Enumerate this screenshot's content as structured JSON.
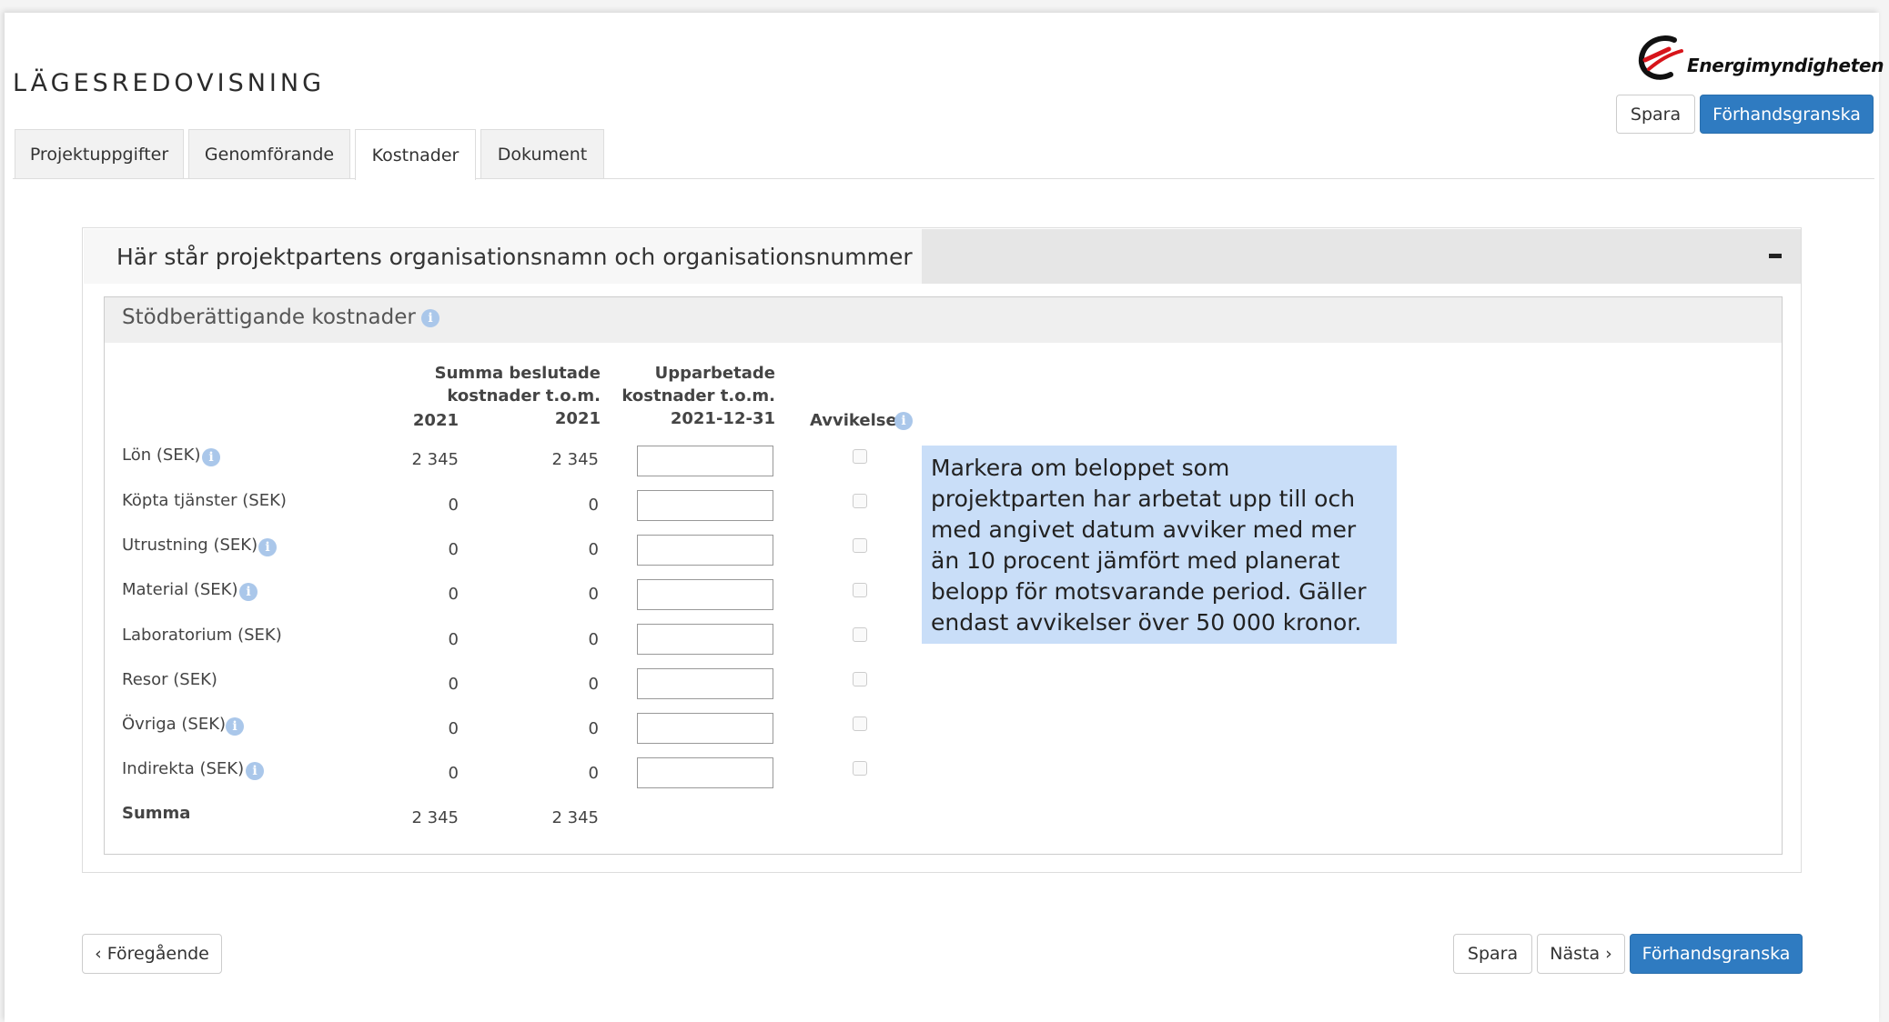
{
  "header": {
    "title": "LÄGESREDOVISNING",
    "logo_text": "Energimyndigheten",
    "save_label": "Spara",
    "preview_label": "Förhandsgranska"
  },
  "tabs": [
    {
      "label": "Projektuppgifter"
    },
    {
      "label": "Genomförande"
    },
    {
      "label": "Kostnader"
    },
    {
      "label": "Dokument"
    }
  ],
  "panel": {
    "title": "Här står projektpartens organisationsnamn och organisationsnummer",
    "section_title": "Stödberättigande kostnader"
  },
  "table": {
    "col1_year": "2021",
    "col2_line1": "Summa beslutade",
    "col2_line2": "kostnader t.o.m.",
    "col2_year": "2021",
    "col3_line1": "Upparbetade",
    "col3_line2": "kostnader t.o.m.",
    "col3_date": "2021-12-31",
    "col4": "Avvikelse",
    "rows": [
      {
        "label": "Lön (SEK)",
        "v1": "2 345",
        "v2": "2 345"
      },
      {
        "label": "Köpta tjänster (SEK)",
        "v1": "0",
        "v2": "0"
      },
      {
        "label": "Utrustning (SEK)",
        "v1": "0",
        "v2": "0"
      },
      {
        "label": "Material (SEK)",
        "v1": "0",
        "v2": "0"
      },
      {
        "label": "Laboratorium (SEK)",
        "v1": "0",
        "v2": "0"
      },
      {
        "label": "Resor (SEK)",
        "v1": "0",
        "v2": "0"
      },
      {
        "label": "Övriga (SEK)",
        "v1": "0",
        "v2": "0"
      },
      {
        "label": "Indirekta (SEK)",
        "v1": "0",
        "v2": "0"
      }
    ],
    "sum": {
      "label": "Summa",
      "v1": "2 345",
      "v2": "2 345"
    }
  },
  "tooltip": "Markera om beloppet som projektparten har arbetat upp till och med angivet datum avviker med mer än 10 procent jämfört med planerat belopp för motsvarande period. Gäller endast avvikelser över 50 000 kronor.",
  "footer": {
    "prev_label": "Föregående",
    "save_label": "Spara",
    "next_label": "Nästa",
    "preview_label": "Förhandsgranska"
  },
  "colors": {
    "primary": "#2f7bc1",
    "tooltip_bg": "#c9def8",
    "info_icon": "#aac7ea"
  }
}
